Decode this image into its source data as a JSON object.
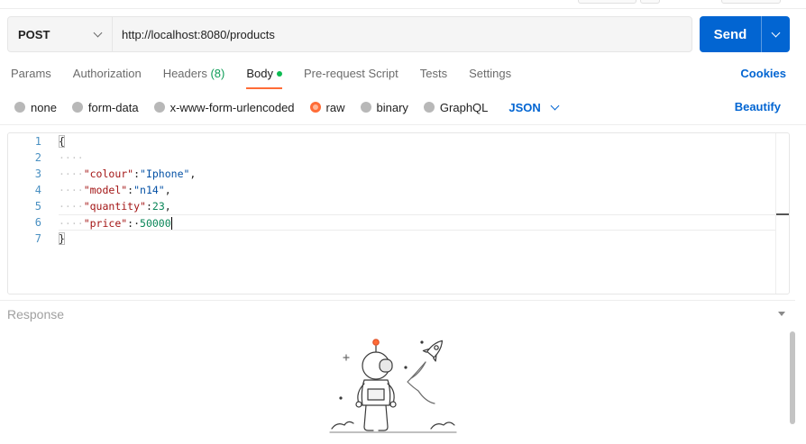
{
  "request": {
    "method": "POST",
    "url": "http://localhost:8080/products",
    "send_label": "Send"
  },
  "tabs": [
    {
      "label": "Params"
    },
    {
      "label": "Authorization"
    },
    {
      "label": "Headers",
      "count": "(8)"
    },
    {
      "label": "Body",
      "active": true
    },
    {
      "label": "Pre-request Script"
    },
    {
      "label": "Tests"
    },
    {
      "label": "Settings"
    }
  ],
  "cookies_label": "Cookies",
  "body_types": [
    {
      "label": "none"
    },
    {
      "label": "form-data"
    },
    {
      "label": "x-www-form-urlencoded"
    },
    {
      "label": "raw",
      "selected": true
    },
    {
      "label": "binary"
    },
    {
      "label": "GraphQL"
    }
  ],
  "language": "JSON",
  "beautify_label": "Beautify",
  "editor": {
    "line_numbers": [
      "1",
      "2",
      "3",
      "4",
      "5",
      "6",
      "7"
    ],
    "open_brace": "{",
    "close_brace": "}",
    "indent": "····",
    "fields": [
      {
        "key": "\"colour\"",
        "sep": ":",
        "value": "\"Iphone\"",
        "value_type": "string",
        "trail": ","
      },
      {
        "key": "\"model\"",
        "sep": ":",
        "value": "\"n14\"",
        "value_type": "string",
        "trail": ","
      },
      {
        "key": "\"quantity\"",
        "sep": ":",
        "value": "23",
        "value_type": "number",
        "trail": ","
      },
      {
        "key": "\"price\"",
        "sep": ":·",
        "value": "50000",
        "value_type": "number",
        "trail": ""
      }
    ]
  },
  "response": {
    "title": "Response"
  },
  "colors": {
    "accent_blue": "#0265d2",
    "accent_orange": "#ff6c37",
    "headers_count_green": "#0f9d58"
  }
}
